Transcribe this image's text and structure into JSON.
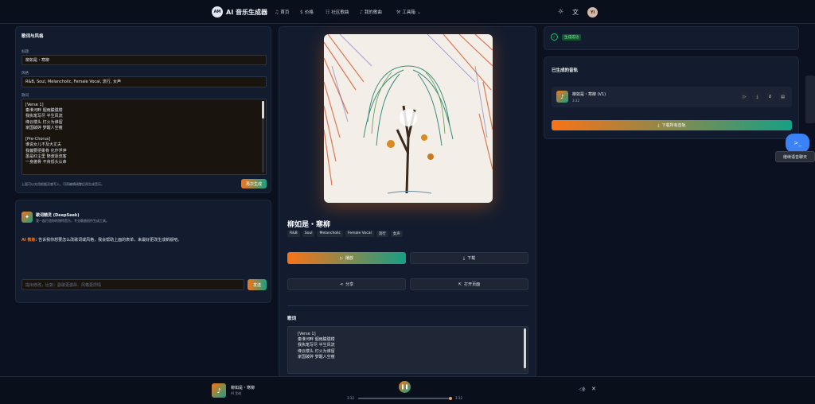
{
  "header": {
    "logo_mark": "AM",
    "app_title": "AI 音乐生成器",
    "nav": [
      {
        "label": "首页",
        "icon": "♫"
      },
      {
        "label": "价格",
        "icon": "$"
      },
      {
        "label": "社区歌曲",
        "icon": "☷"
      },
      {
        "label": "我的歌曲",
        "icon": "♪"
      },
      {
        "label": "工具箱",
        "icon": "⚒"
      }
    ],
    "avatar": "Yi"
  },
  "form": {
    "title": "歌词与风格",
    "title_label": "标题",
    "title_value": "柳如是・寒柳",
    "style_label": "风格",
    "style_value": "R&B, Soul, Melancholic, Female Vocal, 流行, 女声",
    "lyrics_label": "歌词",
    "lyrics_lines": [
      "[Verse 1]",
      "秦淮河畔 烟雨朦胧楼",
      "我执笔写尽 半生风流",
      "绛云楼头 灯火为谁留",
      "家国破碎 梦醒人空瘦",
      "",
      "[Pre-Chorus]",
      "谁说女儿不及大丈夫",
      "我偏要把柔骨 化作浮萍",
      "虽是红尘里 随波逐流客",
      "一身傲骨 不肯低头认命"
    ],
    "hint": "上面可以先用根据灵感写入，可再编辑调整后再生成音乐。",
    "regen_button": "再次生成"
  },
  "assistant": {
    "title": "歌词精灵 (DeepSeek)",
    "subtitle": "我一起打造你的独特音乐，专业歌曲创作生成工具。",
    "ai_label": "AI 教练:",
    "message": "告诉我你想要怎么改歌词或风格，我会帮助上面的表单，来最好更改生成新版吧。",
    "input_placeholder": "提出修改，比如：副歌更激昂、风格更抒情",
    "send_button": "发送"
  },
  "song": {
    "title": "柳如是・寒柳",
    "tags": [
      "R&B",
      "Soul",
      "Melancholic",
      "Female Vocal",
      "流行",
      "女声"
    ],
    "play_button": "播放",
    "download_button": "下载",
    "share_button": "分享",
    "open_button": "打开页面",
    "lyrics_heading": "歌词",
    "lyrics_lines": [
      "[Verse 1]",
      "秦淮河畔 烟雨朦胧楼",
      "我执笔写尽 半生风流",
      "绛云楼头 灯火为谁留",
      "家国破碎 梦醒人空瘦"
    ]
  },
  "status": {
    "text": "生成成功"
  },
  "generated": {
    "title": "已生成的音轨",
    "tracks": [
      {
        "name": "柳如是・寒柳 (V1)",
        "duration": "3:32"
      }
    ],
    "download_all_button": "下载所有音轨"
  },
  "chat_widget": {
    "label": "继续语音聊天"
  },
  "player": {
    "title": "柳如是・寒柳",
    "subtitle": "AI 生成",
    "current_time": "3:32",
    "total_time": "3:32",
    "progress": 1.0
  },
  "colors": {
    "accent_start": "#f97316",
    "accent_end": "#16a085",
    "success": "#22c55e"
  }
}
